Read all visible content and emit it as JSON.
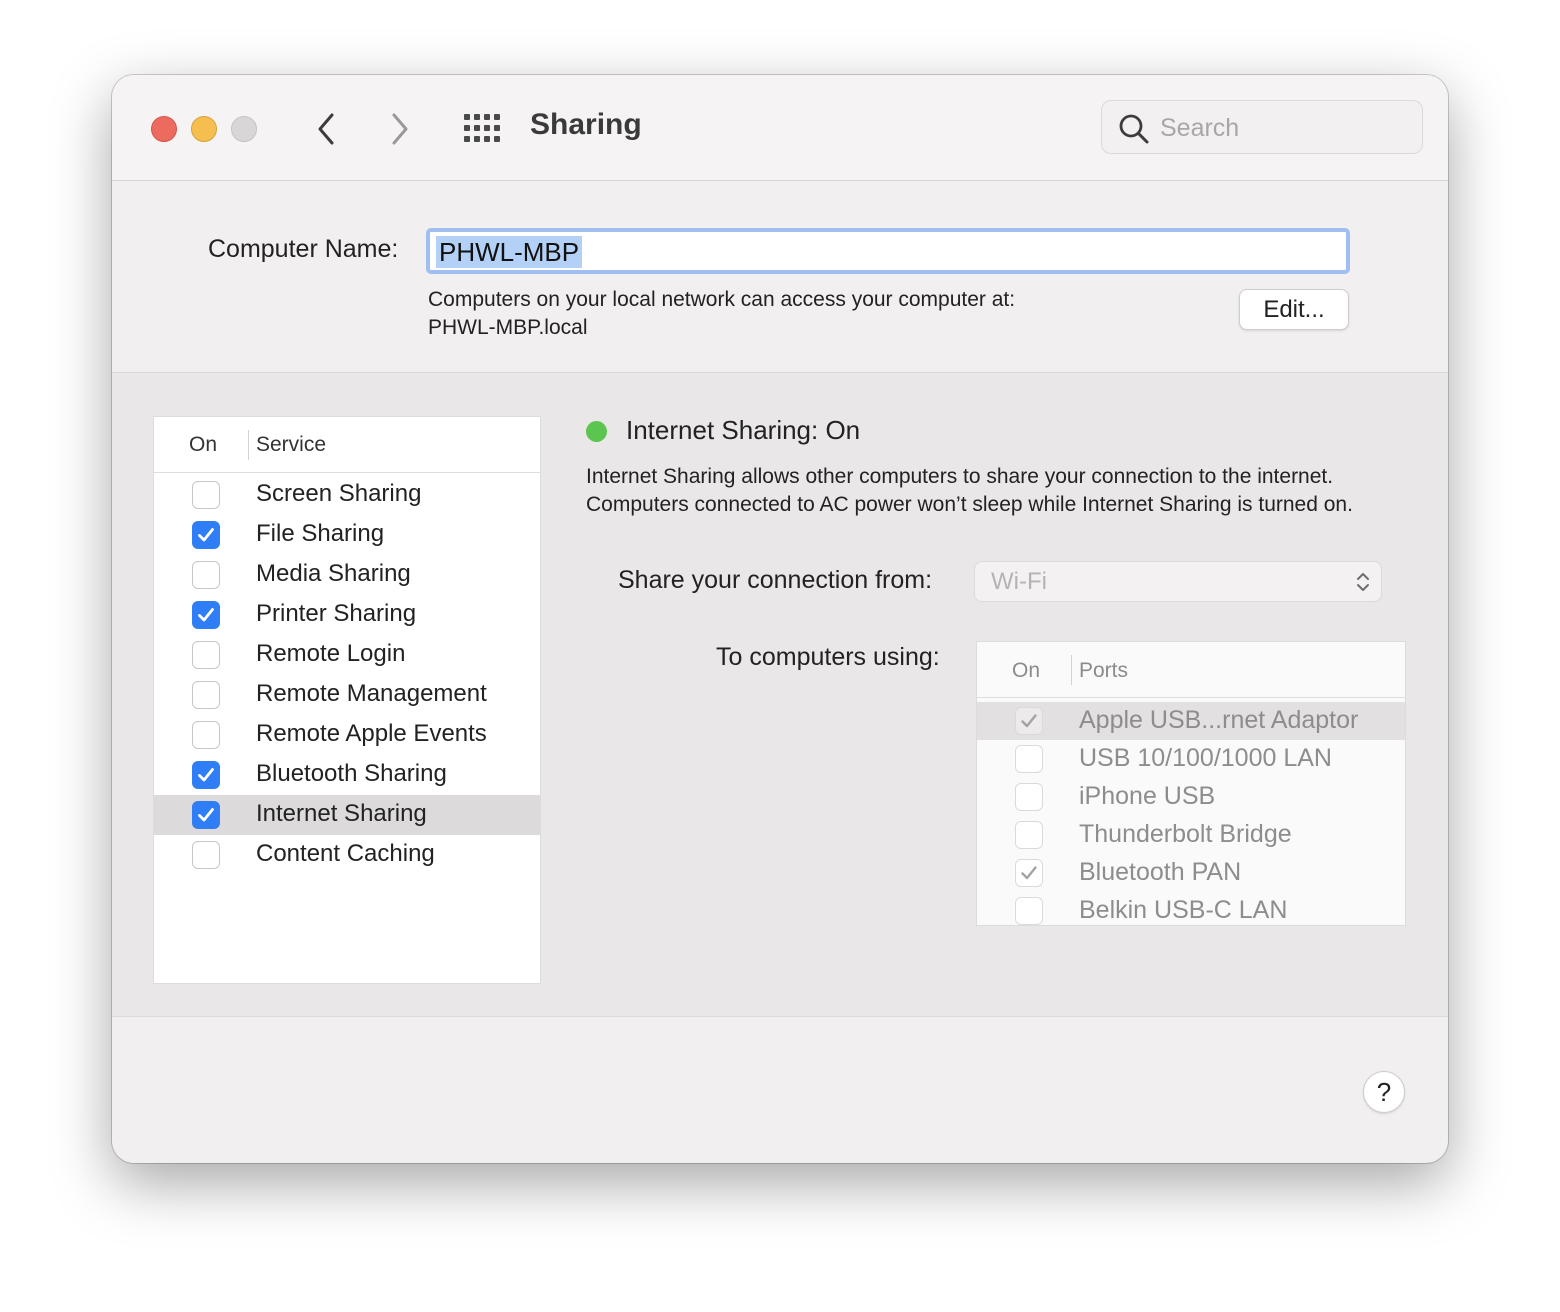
{
  "window": {
    "title": "Sharing",
    "search_placeholder": "Search"
  },
  "icons": {
    "back": "chevron-left-icon",
    "forward": "chevron-right-icon",
    "grid": "grid-icon",
    "search": "magnifying-glass-icon",
    "popup_arrows": "up-down-chevron-icon",
    "checkmark": "checkmark-icon"
  },
  "colors": {
    "accent": "#2f7ef6",
    "status_on": "#5cc54f",
    "close": "#ed6a5e",
    "minimize": "#f5bf4f",
    "zoom_inactive": "#d9d6d7"
  },
  "computer_name": {
    "label": "Computer Name:",
    "value": "PHWL-MBP",
    "description_line1": "Computers on your local network can access your computer at:",
    "description_line2": "PHWL-MBP.local",
    "edit_button": "Edit..."
  },
  "services": {
    "header_on": "On",
    "header_service": "Service",
    "items": [
      {
        "label": "Screen Sharing",
        "checked": false
      },
      {
        "label": "File Sharing",
        "checked": true
      },
      {
        "label": "Media Sharing",
        "checked": false
      },
      {
        "label": "Printer Sharing",
        "checked": true
      },
      {
        "label": "Remote Login",
        "checked": false
      },
      {
        "label": "Remote Management",
        "checked": false
      },
      {
        "label": "Remote Apple Events",
        "checked": false
      },
      {
        "label": "Bluetooth Sharing",
        "checked": true
      },
      {
        "label": "Internet Sharing",
        "checked": true,
        "selected": true
      },
      {
        "label": "Content Caching",
        "checked": false
      }
    ]
  },
  "detail": {
    "status": "Internet Sharing: On",
    "description": "Internet Sharing allows other computers to share your connection to the internet. Computers connected to AC power won’t sleep while Internet Sharing is turned on.",
    "share_from_label": "Share your connection from:",
    "share_from_value": "Wi-Fi",
    "to_computers_label": "To computers using:",
    "ports_header_on": "On",
    "ports_header_ports": "Ports",
    "ports": [
      {
        "label": "Apple USB...rnet Adaptor",
        "checked": true,
        "selected": true
      },
      {
        "label": "USB 10/100/1000 LAN",
        "checked": false
      },
      {
        "label": "iPhone USB",
        "checked": false
      },
      {
        "label": "Thunderbolt Bridge",
        "checked": false
      },
      {
        "label": "Bluetooth PAN",
        "checked": true
      },
      {
        "label": "Belkin USB-C LAN",
        "checked": false
      }
    ]
  },
  "help_button": "?"
}
